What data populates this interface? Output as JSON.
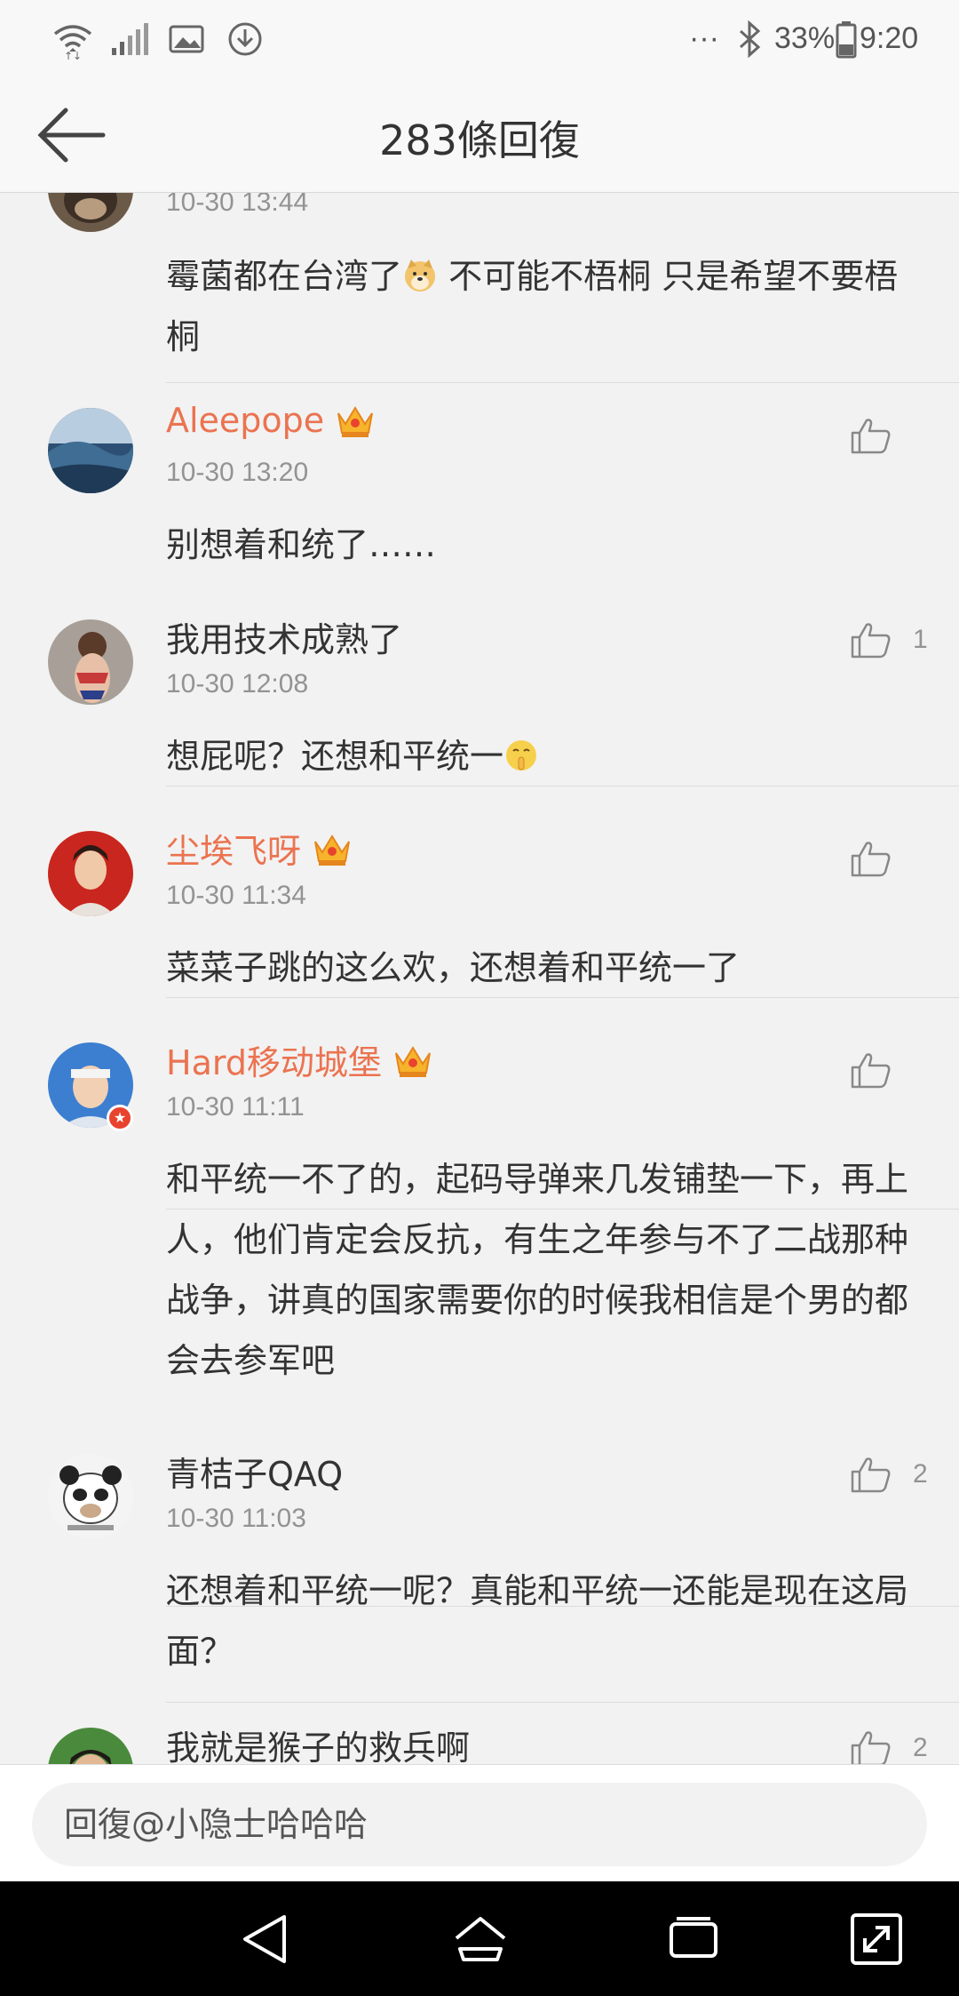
{
  "status_bar": {
    "dots": "···",
    "battery": "33%",
    "time": "9:20",
    "icons": [
      "wifi-icon",
      "signal-icon",
      "image-icon",
      "download-icon",
      "bluetooth-icon",
      "battery-icon"
    ]
  },
  "header": {
    "title": "283條回復",
    "back_icon": "back-arrow-icon"
  },
  "comments": [
    {
      "username": "",
      "timestamp": "10-30 13:44",
      "text_parts": [
        "霉菌都在台湾了",
        "不可能不梧桐 只是希望不要梧桐"
      ],
      "emoji": "doge-emoji",
      "likes": ""
    },
    {
      "username": "Aleepope",
      "vip": true,
      "timestamp": "10-30 13:20",
      "text": "别想着和统了……",
      "likes": ""
    },
    {
      "username": "我用技术成熟了",
      "vip": false,
      "timestamp": "10-30 12:08",
      "text": "想屁呢？还想和平统一",
      "emoji": "shush-emoji",
      "likes": "1"
    },
    {
      "username": "尘埃飞呀",
      "vip": true,
      "timestamp": "10-30 11:34",
      "text": "菜菜子跳的这么欢，还想着和平统一了",
      "likes": ""
    },
    {
      "username": "Hard移动城堡",
      "vip": true,
      "timestamp": "10-30 11:11",
      "text": "和平统一不了的，起码导弹来几发铺垫一下，再上人，他们肯定会反抗，有生之年参与不了二战那种战争，讲真的国家需要你的时候我相信是个男的都会去参军吧",
      "likes": ""
    },
    {
      "username": "青桔子QAQ",
      "vip": false,
      "timestamp": "10-30 11:03",
      "text": "还想着和平统一呢？真能和平统一还能是现在这局面？",
      "likes": "2"
    },
    {
      "username": "我就是猴子的救兵啊",
      "vip": false,
      "timestamp": "",
      "text": "",
      "likes": "2"
    }
  ],
  "reply": {
    "placeholder": "回復@小隐士哈哈哈"
  },
  "nav": {
    "icons": [
      "nav-back-icon",
      "nav-home-icon",
      "nav-recents-icon",
      "nav-expand-icon"
    ]
  },
  "colors": {
    "vip_name": "#eb7350",
    "timestamp": "#939393",
    "background": "#f2f2f2"
  }
}
